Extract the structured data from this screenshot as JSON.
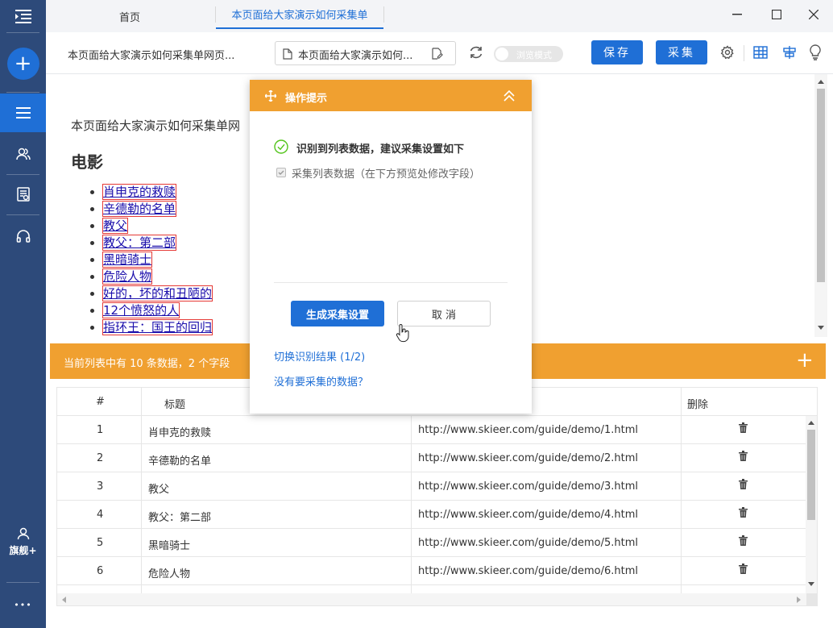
{
  "sidebar": {
    "add_label": "+",
    "user_label": "旗舰+",
    "more_label": "•••"
  },
  "titlebar": {
    "tabs": [
      {
        "label": "首页"
      },
      {
        "label": "本页面给大家演示如何采集单"
      }
    ]
  },
  "toolbar": {
    "page_title": "本页面给大家演示如何采集单网页...",
    "url_value": "本页面给大家演示如何...",
    "browse_mode_label": "浏览模式",
    "save_label": "保存",
    "collect_label": "采集"
  },
  "webpage": {
    "intro": "本页面给大家演示如何采集单网",
    "heading": "电影",
    "movies": [
      "肖申克的救赎",
      "辛德勒的名单",
      "教父",
      "教父：第二部",
      "黑暗骑士",
      "危险人物",
      "好的，坏的和丑陋的",
      "12个愤怒的人",
      "指环王：国王的回归"
    ]
  },
  "dialog": {
    "title": "操作提示",
    "detected": "识别到列表数据，建议采集设置如下",
    "checkbox_label": "采集列表数据（在下方预览处修改字段）",
    "generate_label": "生成采集设置",
    "cancel_label": "取 消",
    "switch_label": "切换识别结果 (1/2)",
    "no_data_label": "没有要采集的数据？"
  },
  "list_bar": {
    "summary": "当前列表中有 10 条数据，2 个字段",
    "add_label": "+"
  },
  "table": {
    "headers": {
      "index": "#",
      "title": "标题",
      "delete": "删除"
    },
    "rows": [
      {
        "index": "1",
        "title": "肖申克的救赎",
        "url": "http://www.skieer.com/guide/demo/1.html"
      },
      {
        "index": "2",
        "title": "辛德勒的名单",
        "url": "http://www.skieer.com/guide/demo/2.html"
      },
      {
        "index": "3",
        "title": "教父",
        "url": "http://www.skieer.com/guide/demo/3.html"
      },
      {
        "index": "4",
        "title": "教父：第二部",
        "url": "http://www.skieer.com/guide/demo/4.html"
      },
      {
        "index": "5",
        "title": "黑暗骑士",
        "url": "http://www.skieer.com/guide/demo/5.html"
      },
      {
        "index": "6",
        "title": "危险人物",
        "url": "http://www.skieer.com/guide/demo/6.html"
      }
    ]
  },
  "colors": {
    "sidebar": "#2d4a7a",
    "accent": "#1f6fd6",
    "orange": "#f0a030",
    "success": "#52c41a"
  }
}
